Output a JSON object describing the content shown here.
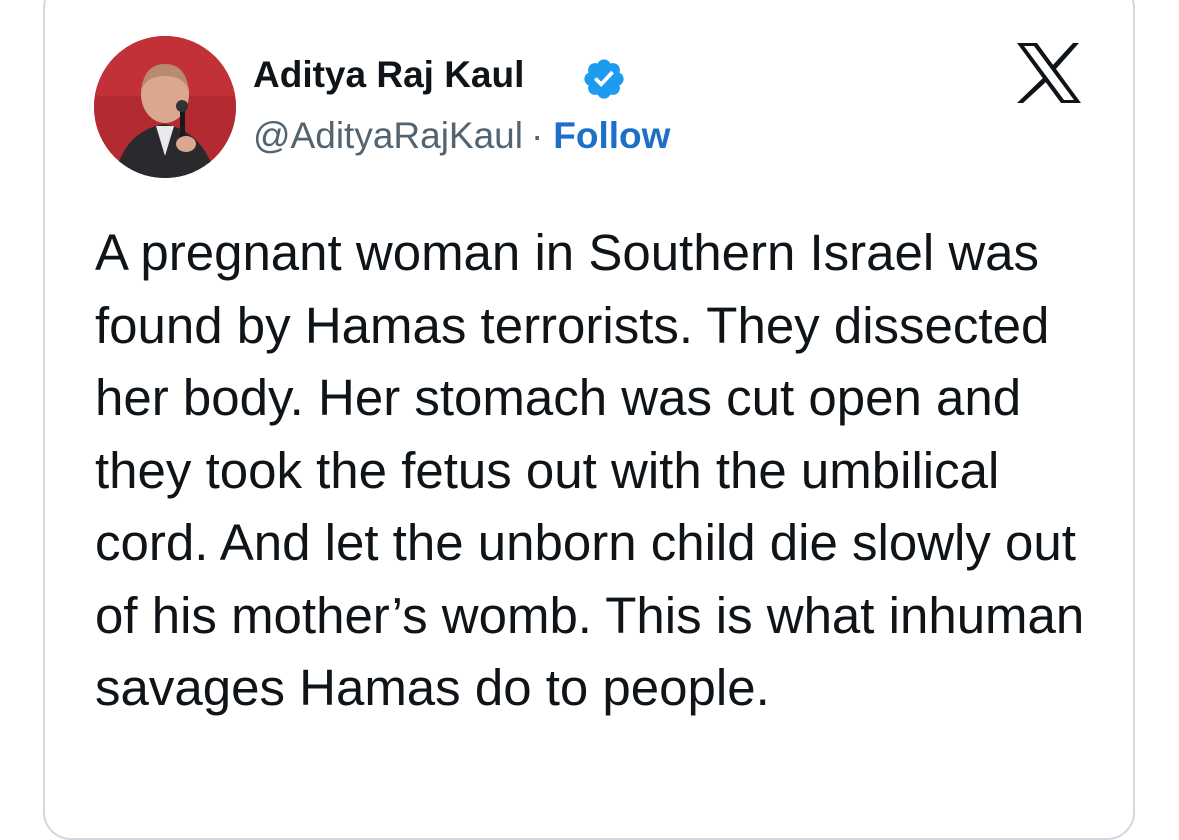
{
  "author": {
    "display_name": "Aditya Raj Kaul",
    "handle": "@AdityaRajKaul",
    "separator": "·",
    "follow_label": "Follow",
    "verified": true,
    "verified_color": "#1d9bf0"
  },
  "brand": {
    "logo_icon": "x-logo-icon"
  },
  "tweet": {
    "text": "A pregnant woman in Southern Israel was found by Hamas terrorists. They dissected her body. Her stomach was cut open and they took the fetus out with the umbilical cord. And let the unborn child die slowly out of his mother’s womb. This is what inhuman savages Hamas do to people."
  },
  "colors": {
    "text": "#0f1419",
    "secondary": "#536471",
    "link": "#1d6fc7",
    "border": "#cfd9de"
  }
}
